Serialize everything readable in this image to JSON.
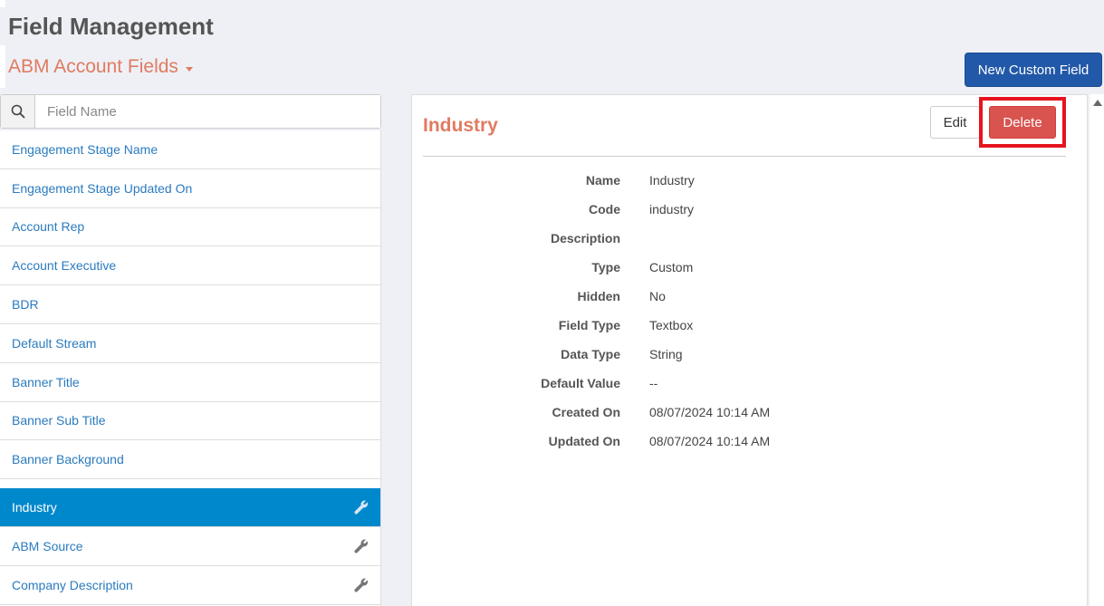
{
  "header": {
    "title": "Field Management",
    "field_set": "ABM Account Fields",
    "new_button": "New Custom Field"
  },
  "search": {
    "placeholder": "Field Name",
    "value": ""
  },
  "fields": [
    {
      "label": "Engagement Stage Name"
    },
    {
      "label": "Engagement Stage Updated On"
    },
    {
      "label": "Account Rep"
    },
    {
      "label": "Account Executive"
    },
    {
      "label": "BDR"
    },
    {
      "label": "Default Stream"
    },
    {
      "label": "Banner Title"
    },
    {
      "label": "Banner Sub Title"
    },
    {
      "label": "Banner Background"
    },
    {
      "label": "Industry"
    },
    {
      "label": "ABM Source"
    },
    {
      "label": "Company Description"
    }
  ],
  "detail": {
    "title": "Industry",
    "edit_label": "Edit",
    "delete_label": "Delete",
    "props": [
      {
        "label": "Name",
        "value": "Industry"
      },
      {
        "label": "Code",
        "value": "industry"
      },
      {
        "label": "Description",
        "value": ""
      },
      {
        "label": "Type",
        "value": "Custom"
      },
      {
        "label": "Hidden",
        "value": "No"
      },
      {
        "label": "Field Type",
        "value": "Textbox"
      },
      {
        "label": "Data Type",
        "value": "String"
      },
      {
        "label": "Default Value",
        "value": "--"
      },
      {
        "label": "Created On",
        "value": "08/07/2024 10:14 AM"
      },
      {
        "label": "Updated On",
        "value": "08/07/2024 10:14 AM"
      }
    ]
  },
  "colors": {
    "accent": "#e07b61",
    "primary": "#2258a8",
    "active_item": "#0088cc",
    "danger": "#d9534f",
    "highlight": "#e5141e"
  }
}
